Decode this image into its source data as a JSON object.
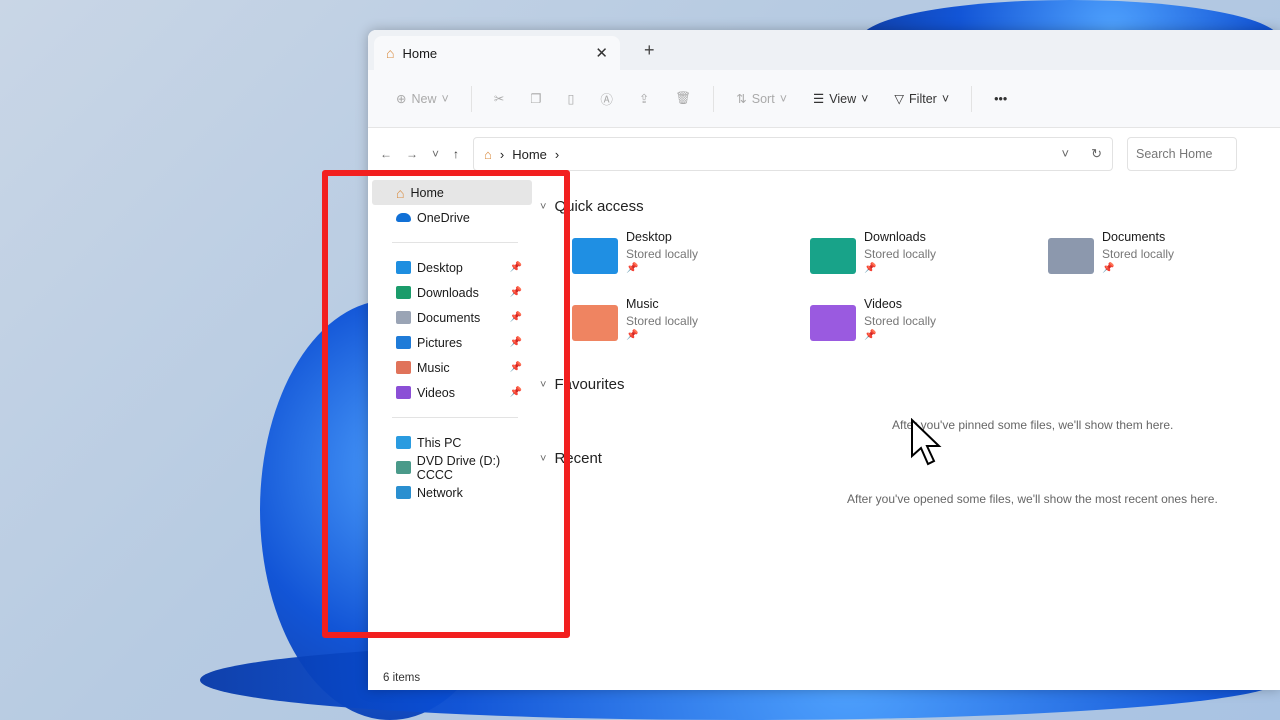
{
  "tab": {
    "title": "Home",
    "close": "✕",
    "new_tab": "+"
  },
  "toolbar": {
    "new": "New",
    "sort": "Sort",
    "view": "View",
    "filter": "Filter",
    "more": "•••"
  },
  "address": {
    "crumb": "Home",
    "search_placeholder": "Search Home"
  },
  "sidebar": {
    "top": [
      {
        "label": "Home",
        "icon": "home-icon"
      },
      {
        "label": "OneDrive",
        "icon": "cloud-icon"
      }
    ],
    "pinned": [
      {
        "label": "Desktop",
        "color": "#1e8ee0"
      },
      {
        "label": "Downloads",
        "color": "#1b9c6b"
      },
      {
        "label": "Documents",
        "color": "#9aa4b5"
      },
      {
        "label": "Pictures",
        "color": "#1f7bd8"
      },
      {
        "label": "Music",
        "color": "#e0735a"
      },
      {
        "label": "Videos",
        "color": "#8b4fd6"
      }
    ],
    "devices": [
      {
        "label": "This PC",
        "color": "#2a9be0"
      },
      {
        "label": "DVD Drive (D:) CCCC",
        "color": "#4a9a8a"
      },
      {
        "label": "Network",
        "color": "#2a8fd0"
      }
    ]
  },
  "main": {
    "quick_access": "Quick access",
    "favourites": "Favourites",
    "recent": "Recent",
    "folders": [
      {
        "name": "Desktop",
        "sub": "Stored locally",
        "color": "#1f8fe3"
      },
      {
        "name": "Downloads",
        "sub": "Stored locally",
        "color": "#18a389"
      },
      {
        "name": "Documents",
        "sub": "Stored locally",
        "color": "#8c98ad"
      },
      {
        "name": "Music",
        "sub": "Stored locally",
        "color": "#ef8461"
      },
      {
        "name": "Videos",
        "sub": "Stored locally",
        "color": "#9a5ae0"
      }
    ],
    "fav_empty": "After you've pinned some files, we'll show them here.",
    "recent_empty": "After you've opened some files, we'll show the most recent ones here."
  },
  "status": "6 items"
}
